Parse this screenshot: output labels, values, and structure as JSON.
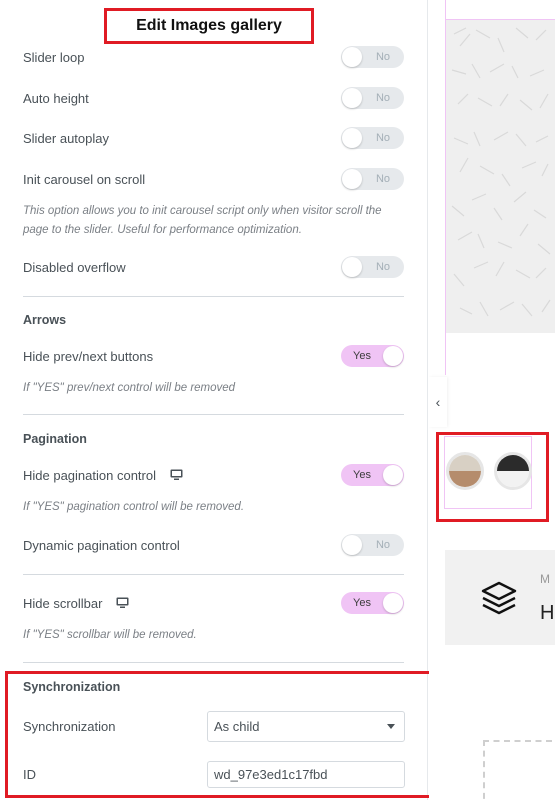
{
  "panel": {
    "title": "Edit Images gallery",
    "slider_options": [
      {
        "label": "Slider loop",
        "value": "No"
      },
      {
        "label": "Auto height",
        "value": "No"
      },
      {
        "label": "Slider autoplay",
        "value": "No"
      },
      {
        "label": "Init carousel on scroll",
        "value": "No"
      }
    ],
    "init_note": "This option allows you to init carousel script only when visitor scroll the page to the slider. Useful for performance optimization.",
    "disabled_overflow": {
      "label": "Disabled overflow",
      "value": "No"
    },
    "arrows": {
      "title": "Arrows",
      "hide_buttons": {
        "label": "Hide prev/next buttons",
        "value": "Yes"
      },
      "note": "If \"YES\" prev/next control will be removed"
    },
    "pagination": {
      "title": "Pagination",
      "hide_control": {
        "label": "Hide pagination control",
        "value": "Yes"
      },
      "hide_note": "If \"YES\" pagination control will be removed.",
      "dynamic": {
        "label": "Dynamic pagination control",
        "value": "No"
      },
      "hide_scrollbar": {
        "label": "Hide scrollbar",
        "value": "Yes"
      },
      "scrollbar_note": "If \"YES\" scrollbar will be removed."
    },
    "synchronization": {
      "title": "Synchronization",
      "sync_label": "Synchronization",
      "sync_value": "As child",
      "id_label": "ID",
      "id_value": "wd_97e3ed1c17fbd"
    }
  },
  "preview": {
    "collapse_icon": "chevron-left-icon",
    "swatches": [
      {
        "top": "#d8d0c4",
        "bottom": "#b58c6c"
      },
      {
        "top": "#2b2b2b",
        "bottom": "#f2f2f2"
      }
    ],
    "widget_mini": "M",
    "widget_big": "H"
  },
  "colors": {
    "toggle_on": "#f0c4f5",
    "toggle_off": "#e6e9ec",
    "highlight": "#e01b24"
  }
}
